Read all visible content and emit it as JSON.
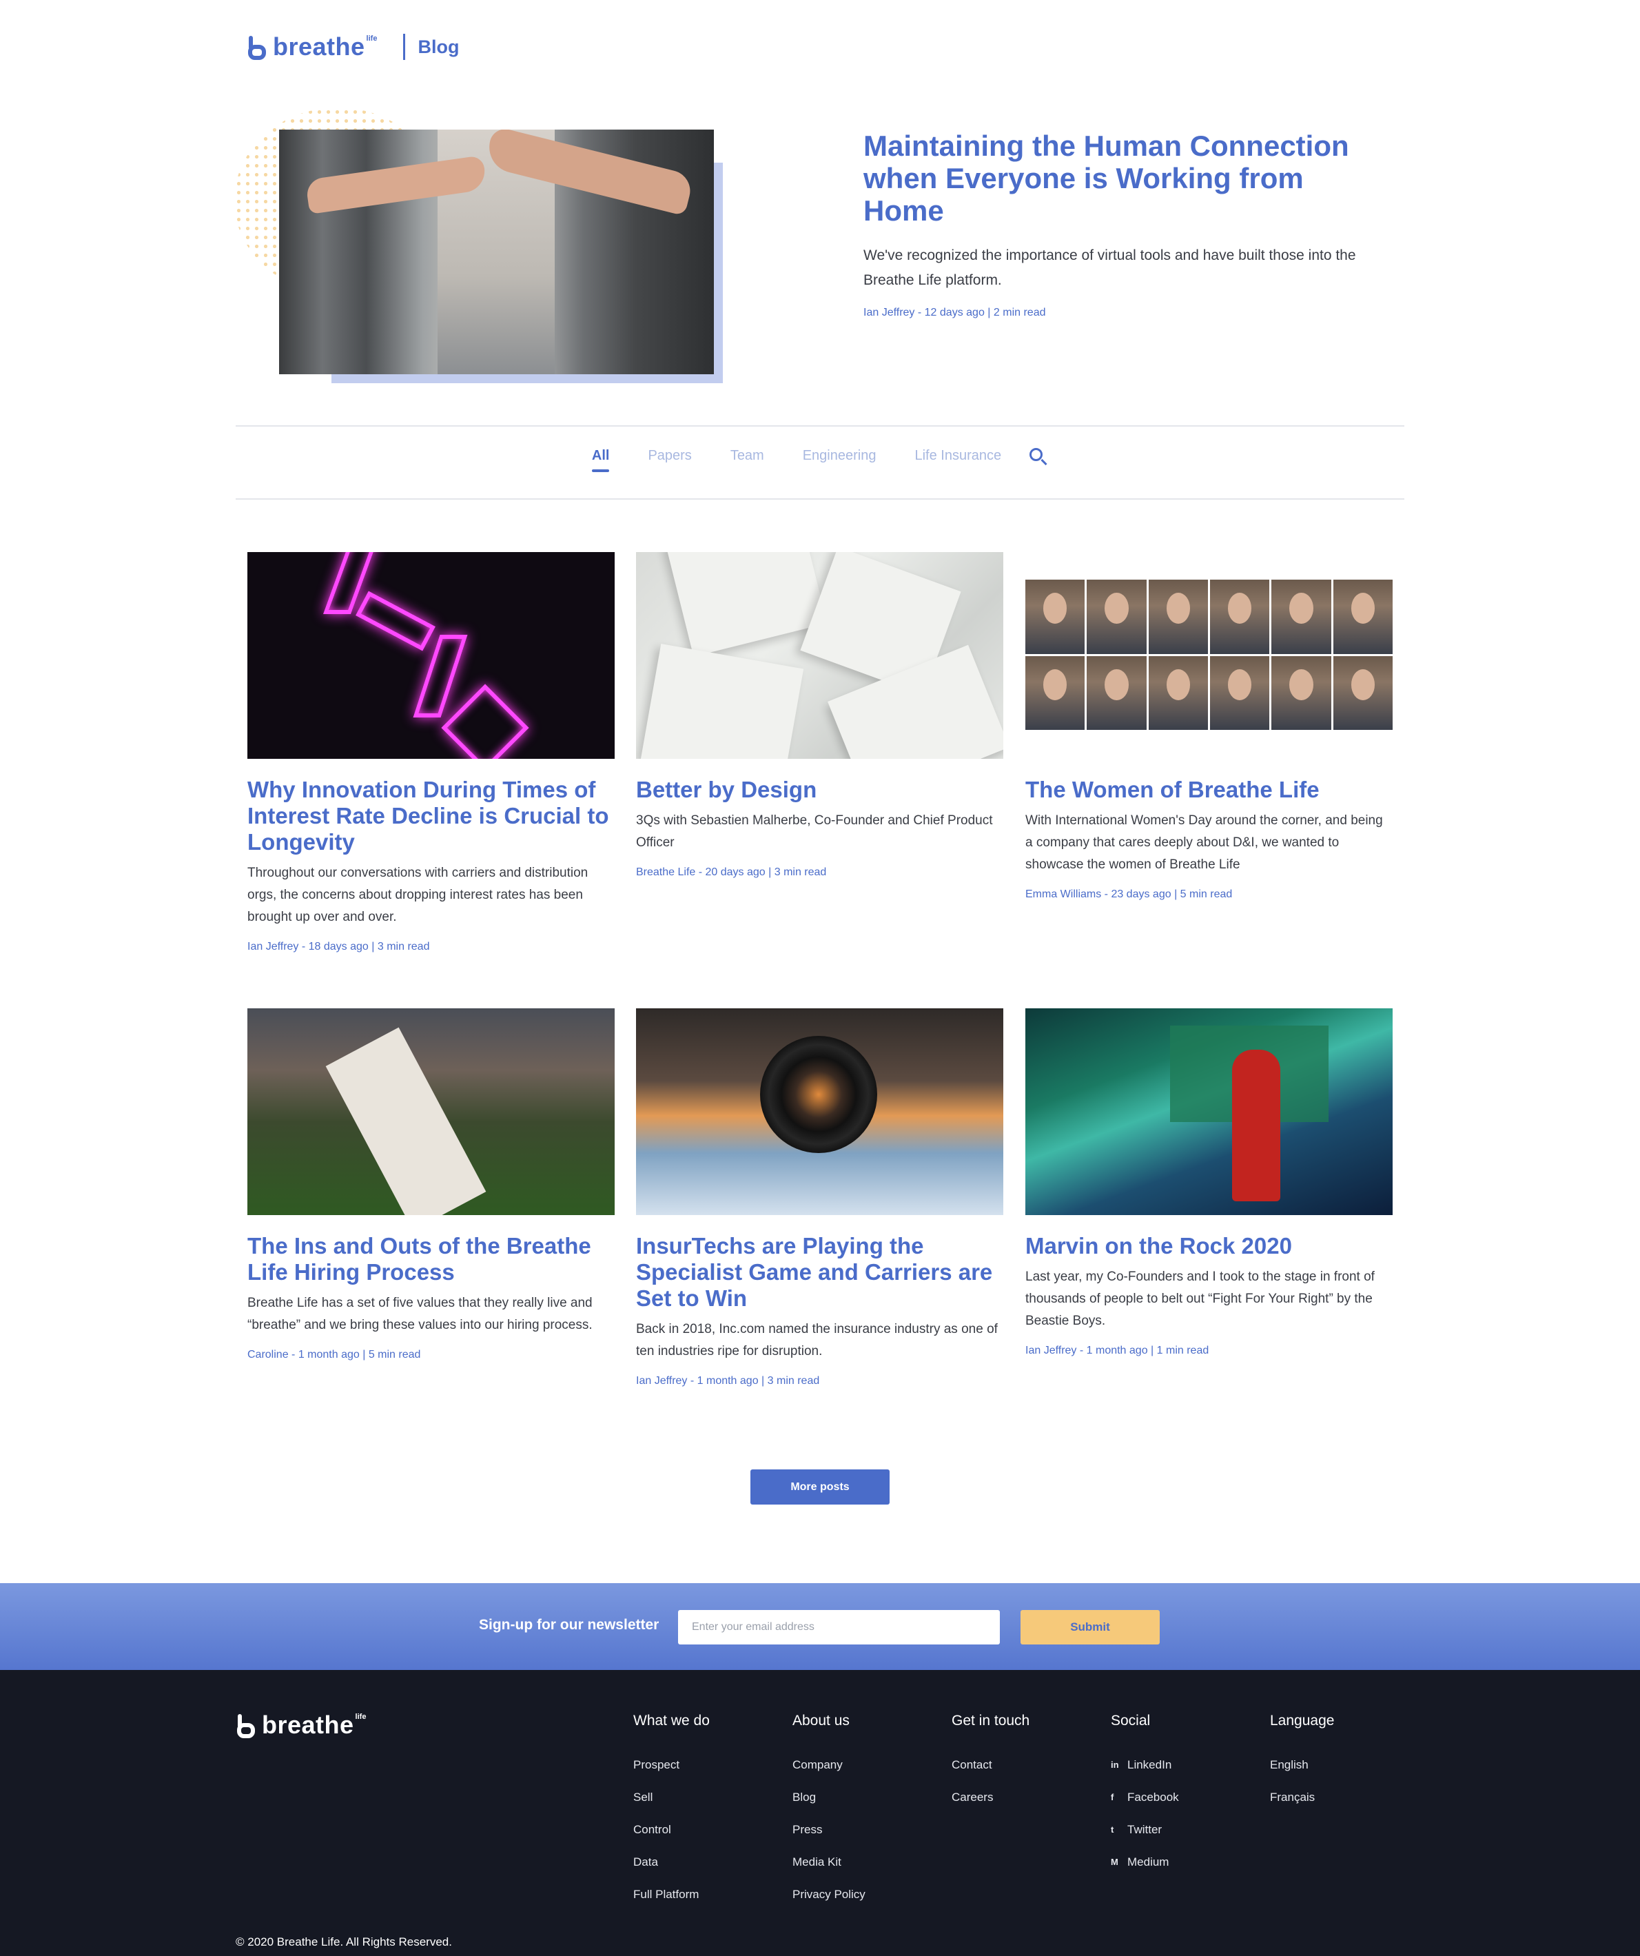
{
  "header": {
    "logo_text": "breathe",
    "logo_sup": "life",
    "section": "Blog"
  },
  "featured": {
    "title": "Maintaining the Human Connection when Everyone is Working from Home",
    "excerpt": "We've recognized the importance of virtual tools and have built those into the Breathe Life platform.",
    "author": "Ian Jeffrey",
    "date": "12 days ago",
    "read": "2 min read"
  },
  "filters": [
    {
      "label": "All",
      "active": true
    },
    {
      "label": "Papers",
      "active": false
    },
    {
      "label": "Team",
      "active": false
    },
    {
      "label": "Engineering",
      "active": false
    },
    {
      "label": "Life Insurance",
      "active": false
    }
  ],
  "posts": [
    {
      "title": "Why Innovation During Times of Interest Rate Decline is Crucial to Longevity",
      "excerpt": "Throughout our conversations with carriers and distribution orgs, the concerns about dropping interest rates has been brought up over and over.",
      "author": "Ian Jeffrey",
      "date": "18 days ago",
      "read": "3 min read"
    },
    {
      "title": "Better by Design",
      "excerpt": "3Qs with Sebastien Malherbe, Co-Founder and Chief Product Officer",
      "author": "Breathe Life",
      "date": "20 days ago",
      "read": "3 min read"
    },
    {
      "title": "The Women of Breathe Life",
      "excerpt": "With International Women's Day around the corner, and being a company that cares deeply about D&I, we wanted to showcase the women of Breathe Life",
      "author": "Emma Williams",
      "date": "23 days ago",
      "read": "5 min read"
    },
    {
      "title": "The Ins and Outs of the Breathe Life Hiring Process",
      "excerpt": "Breathe Life has a set of five values that they really live and “breathe” and we bring these values into our hiring process.",
      "author": "Caroline",
      "date": "1 month ago",
      "read": "5 min read"
    },
    {
      "title": "InsurTechs are Playing the Specialist Game and Carriers are Set to Win",
      "excerpt": "Back in 2018, Inc.com named the insurance industry as one of ten industries ripe for disruption.",
      "author": "Ian Jeffrey",
      "date": "1 month ago",
      "read": "3 min read"
    },
    {
      "title": "Marvin on the Rock 2020",
      "excerpt": "Last year, my Co-Founders and I took to the stage in front of thousands of people to belt out “Fight For Your Right” by the Beastie Boys.",
      "author": "Ian Jeffrey",
      "date": "1 month ago",
      "read": "1 min read"
    }
  ],
  "more_posts_label": "More posts",
  "newsletter": {
    "label": "Sign-up for our newsletter",
    "placeholder": "Enter your email address",
    "submit": "Submit"
  },
  "footer": {
    "columns": [
      {
        "heading": "What we do",
        "links": [
          "Prospect",
          "Sell",
          "Control",
          "Data",
          "Full Platform"
        ]
      },
      {
        "heading": "About us",
        "links": [
          "Company",
          "Blog",
          "Press",
          "Media Kit",
          "Privacy Policy"
        ]
      },
      {
        "heading": "Get in touch",
        "links": [
          "Contact",
          "Careers"
        ]
      },
      {
        "heading": "Social",
        "links": [
          "LinkedIn",
          "Facebook",
          "Twitter",
          "Medium"
        ]
      },
      {
        "heading": "Language",
        "links": [
          "English",
          "Français"
        ]
      }
    ],
    "social_glyphs": [
      "in",
      "f",
      "t",
      "M"
    ],
    "copyright": "© 2020 Breathe Life. All Rights Reserved."
  },
  "colors": {
    "brand_blue": "#4a6cc9",
    "accent_yellow": "#f6c97a",
    "footer_bg": "#151823"
  }
}
